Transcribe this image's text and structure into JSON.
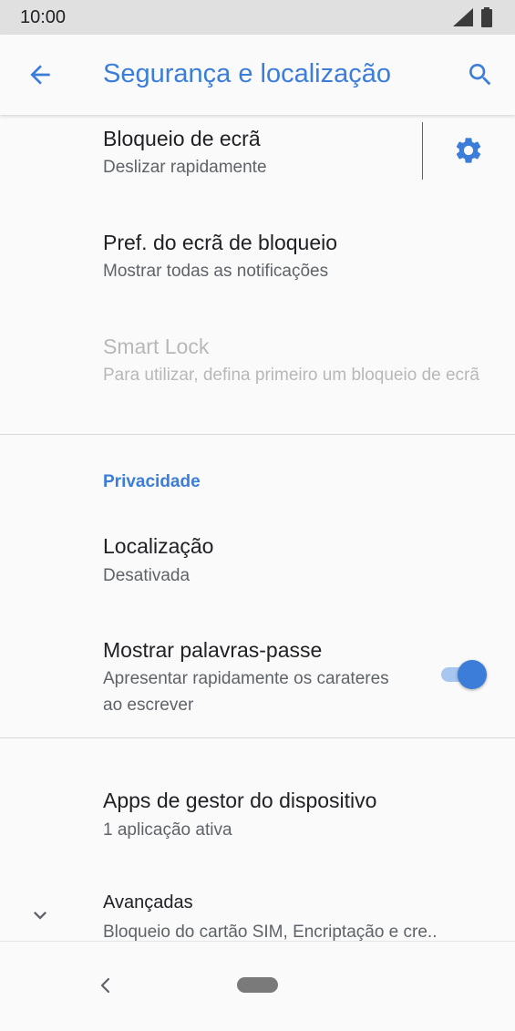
{
  "status_bar": {
    "time": "10:00"
  },
  "app_bar": {
    "title": "Segurança e localização",
    "back_icon": "arrow-left-icon",
    "search_icon": "search-icon"
  },
  "items": {
    "screen_lock": {
      "title": "Bloqueio de ecrã",
      "subtitle": "Deslizar rapidamente",
      "action_icon": "gear-icon"
    },
    "lock_prefs": {
      "title": "Pref. do ecrã de bloqueio",
      "subtitle": "Mostrar todas as notificações"
    },
    "smart_lock": {
      "title": "Smart Lock",
      "subtitle": "Para utilizar, defina primeiro um bloqueio de ecrã",
      "enabled": false
    },
    "location": {
      "title": "Localização",
      "subtitle": "Desativada"
    },
    "show_passwords": {
      "title": "Mostrar palavras-passe",
      "subtitle": "Apresentar rapidamente os carateres ao escrever",
      "toggle_on": true
    },
    "device_admin": {
      "title": "Apps de gestor do dispositivo",
      "subtitle": "1 aplicação ativa"
    },
    "advanced": {
      "title": "Avançadas",
      "subtitle": "Bloqueio do cartão SIM, Encriptação e cre..",
      "icon": "chevron-down-icon"
    }
  },
  "sections": {
    "privacy": "Privacidade"
  },
  "colors": {
    "accent": "#3b7dd8",
    "toggle_track": "#a8c7f0",
    "status_bar": "#e0e0e0",
    "background": "#fafafa"
  }
}
